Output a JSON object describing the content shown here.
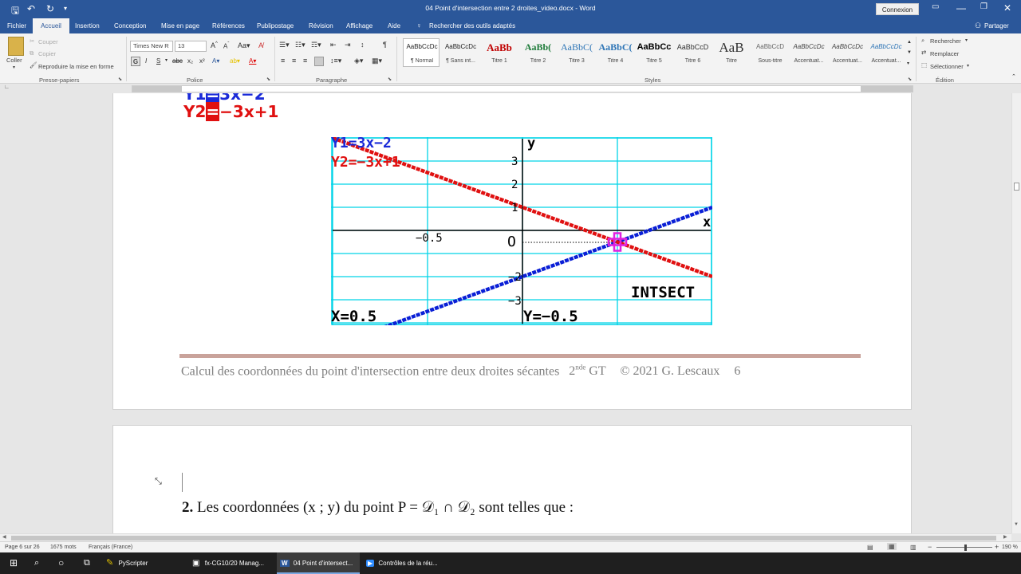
{
  "app": {
    "doc_title": "04 Point d'intersection entre 2 droites_video.docx - Word",
    "connexion": "Connexion"
  },
  "tabs": [
    "Fichier",
    "Accueil",
    "Insertion",
    "Conception",
    "Mise en page",
    "Références",
    "Publipostage",
    "Révision",
    "Affichage",
    "Aide"
  ],
  "search_tools": "Rechercher des outils adaptés",
  "share": "Partager",
  "clipboard": {
    "paste": "Coller",
    "cut": "Couper",
    "copy": "Copier",
    "format_painter": "Reproduire la mise en forme",
    "group": "Presse-papiers"
  },
  "font": {
    "name": "Times New R",
    "size": "13",
    "group": "Police",
    "bold": "G",
    "italic": "I",
    "underline": "S"
  },
  "paragraph_group": "Paragraphe",
  "styles": {
    "group": "Styles",
    "items": [
      {
        "preview": "AaBbCcDc",
        "name": "¶ Normal"
      },
      {
        "preview": "AaBbCcDc",
        "name": "¶ Sans int..."
      },
      {
        "preview": "AaBb",
        "name": "Titre 1"
      },
      {
        "preview": "AaBb(",
        "name": "Titre 2"
      },
      {
        "preview": "AaBbC(",
        "name": "Titre 3"
      },
      {
        "preview": "AaBbC(",
        "name": "Titre 4"
      },
      {
        "preview": "AaBbCc",
        "name": "Titre 5"
      },
      {
        "preview": "AaBbCcD",
        "name": "Titre 6"
      },
      {
        "preview": "AaB",
        "name": "Titre"
      },
      {
        "preview": "AaBbCcD",
        "name": "Sous-titre"
      },
      {
        "preview": "AaBbCcDc",
        "name": "Accentuat..."
      },
      {
        "preview": "AaBbCcDc",
        "name": "Accentuat..."
      },
      {
        "preview": "AaBbCcDc",
        "name": "Accentuat..."
      }
    ]
  },
  "editing": {
    "find": "Rechercher",
    "replace": "Remplacer",
    "select": "Sélectionner",
    "group": "Édition"
  },
  "document": {
    "eq1_prefix": "Y1",
    "eq1_rest": "3x−2",
    "eq2_prefix": "Y2",
    "eq2_rest": "−3x+1",
    "calc": {
      "y1_label": "Y1=3x−2",
      "y2_label": "Y2=−3x+1",
      "y_axis": "y",
      "x_axis": "x",
      "origin": "O",
      "tick_neg05": "−0.5",
      "tick_3": "3",
      "tick_2": "2",
      "tick_1": "1",
      "tick_m2": "−2",
      "tick_m3": "−3",
      "intsect": "INTSECT",
      "x_result": "X=0.5",
      "y_result": "Y=−0.5"
    },
    "footer": {
      "text": "Calcul des coordonnées du point d'intersection entre deux droites sécantes",
      "level": "2",
      "level_sup": "nde",
      "level_suffix": " GT",
      "copyright": "© 2021 G. Lescaux",
      "page": "6"
    },
    "next_page_num": "2.",
    "next_page_text": " Les coordonnées (x ; y) du point P = 𝒟₁ ∩ 𝒟₂ sont telles que :"
  },
  "status": {
    "page": "Page 6 sur 26",
    "words": "1675 mots",
    "lang": "Français (France)",
    "zoom": "190 %"
  },
  "taskbar": {
    "apps": [
      "PyScripter",
      "fx-CG10/20 Manag...",
      "04 Point d'intersect...",
      "Contrôles de la réu..."
    ]
  },
  "colors": {
    "word_blue": "#2b579a",
    "series_y1": "#0a1fd6",
    "series_y2": "#e01010",
    "grid": "#00d4e8"
  },
  "chart_data": {
    "type": "line",
    "xlim": [
      -1.0,
      1.0
    ],
    "ylim": [
      -4.0,
      4.0
    ],
    "series": [
      {
        "name": "Y1=3x−2",
        "slope": 3,
        "intercept": -2
      },
      {
        "name": "Y2=−3x+1",
        "slope": -3,
        "intercept": 1
      }
    ],
    "intersection": {
      "x": 0.5,
      "y": -0.5
    }
  }
}
